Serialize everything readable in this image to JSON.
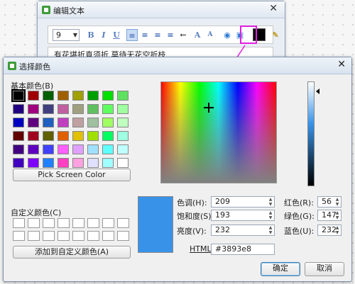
{
  "background_window": {
    "title": "编辑文本",
    "close_glyph": "✕",
    "font_size_value": "9",
    "toolbar_icons": [
      "B",
      "I",
      "U",
      "≡",
      "≡",
      "≡",
      "≡",
      "←",
      "A",
      "A"
    ],
    "text": "有花堪折直须折 莫待无花空折枝",
    "current_color": "#000000"
  },
  "dialog": {
    "title": "选择颜色",
    "close_glyph": "✕",
    "basic_colors_label": "基本颜色(B)",
    "basic_colors": [
      [
        "#000000",
        "#a00000",
        "#006000",
        "#a06000",
        "#a0a000",
        "#00a000",
        "#00e000",
        "#60e060"
      ],
      [
        "#200080",
        "#a00080",
        "#404080",
        "#c060a0",
        "#a0a080",
        "#60c060",
        "#60ff60",
        "#a0ffa0"
      ],
      [
        "#0000c0",
        "#600080",
        "#2060c0",
        "#c040c0",
        "#c0a0a0",
        "#a0c0a0",
        "#a0ff60",
        "#c0ffc0"
      ],
      [
        "#600000",
        "#a00020",
        "#606000",
        "#e06000",
        "#e0c000",
        "#a0e000",
        "#00ff60",
        "#a0ffe0"
      ],
      [
        "#400080",
        "#6000c0",
        "#4040ff",
        "#ff60ff",
        "#e0a0ff",
        "#a0e0ff",
        "#60ffff",
        "#c0ffff"
      ],
      [
        "#4000c0",
        "#8000ff",
        "#2080ff",
        "#ff40c0",
        "#ffa0e0",
        "#e0e0ff",
        "#a0ffff",
        "#ffffff"
      ]
    ],
    "pick_screen_button": "Pick Screen Color",
    "custom_colors_label": "自定义颜色(C)",
    "add_custom_button": "添加到自定义颜色(A)",
    "fields": {
      "hue": {
        "label": "色调(H):",
        "value": "209"
      },
      "sat": {
        "label": "饱和度(S):",
        "value": "193"
      },
      "val": {
        "label": "亮度(V):",
        "value": "232"
      },
      "red": {
        "label": "红色(R):",
        "value": "56"
      },
      "green": {
        "label": "绿色(G):",
        "value": "147"
      },
      "blue": {
        "label": "蓝色(U):",
        "value": "232"
      },
      "html": {
        "label": "HTML:",
        "value": "#3893e8"
      }
    },
    "ok_button": "确定",
    "cancel_button": "取消",
    "preview_color": "#3893e8",
    "accent": "#e21ee0"
  }
}
